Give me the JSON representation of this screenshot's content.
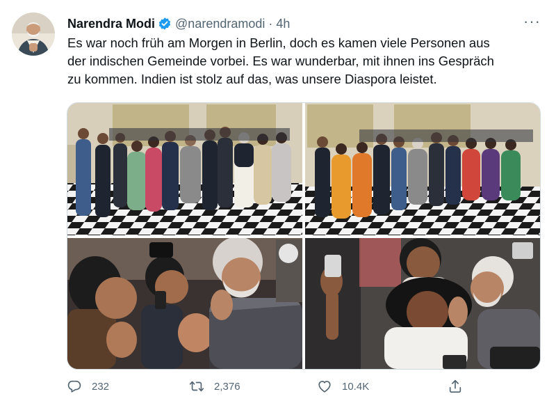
{
  "tweet": {
    "author_name": "Narendra Modi",
    "handle": "@narendramodi",
    "separator": "·",
    "time": "4h",
    "more": "···",
    "text_lines": [
      "Es war noch früh am Morgen in Berlin, doch es kamen viele Personen aus",
      "der indischen Gemeinde vorbei. Es war wunderbar, mit ihnen ins Gespräch",
      "zu kommen. Indien ist stolz auf das, was unsere Diaspora leistet."
    ]
  },
  "actions": {
    "replies": "232",
    "retweets": "2,376",
    "likes": "10.4K"
  },
  "colors": {
    "verified": "#1d9bf0",
    "secondary_text": "#536471",
    "primary_text": "#0f1419"
  },
  "icons": [
    "verified-badge-icon",
    "more-options-icon",
    "reply-icon",
    "retweet-icon",
    "like-icon",
    "share-icon"
  ]
}
